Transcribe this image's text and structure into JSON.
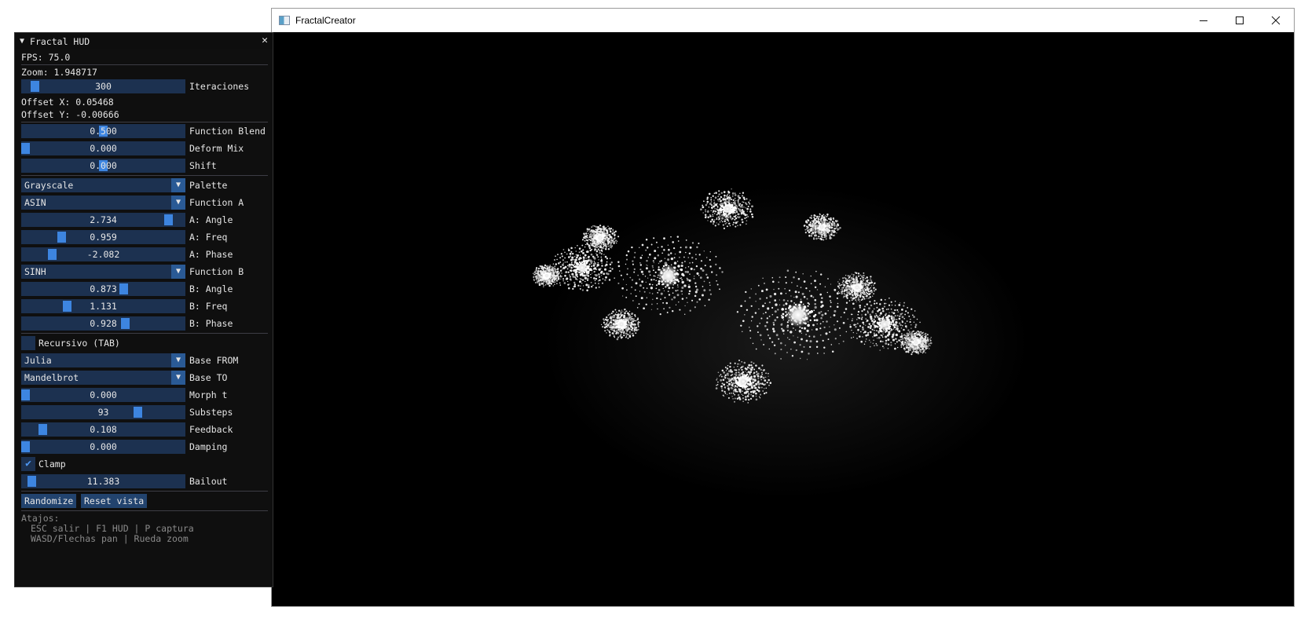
{
  "window": {
    "title": "FractalCreator",
    "controls": {
      "minimize_icon": "minimize-icon",
      "maximize_icon": "maximize-icon",
      "close_icon": "close-icon"
    }
  },
  "hud": {
    "title": "Fractal HUD",
    "collapse_icon": "▼",
    "close_icon": "✕",
    "fps": "FPS: 75.0",
    "zoom": "Zoom: 1.948717",
    "iteraciones": {
      "value": "300",
      "label": "Iteraciones",
      "level": 0.06
    },
    "offset_x": "Offset X: 0.05468",
    "offset_y": "Offset Y: -0.00666",
    "function_blend": {
      "value": "0.500",
      "label": "Function Blend",
      "level": 0.5
    },
    "deform_mix": {
      "value": "0.000",
      "label": "Deform Mix",
      "level": 0.0
    },
    "shift": {
      "value": "0.000",
      "label": "Shift",
      "level": 0.5
    },
    "palette": {
      "value": "Grayscale",
      "label": "Palette"
    },
    "function_a": {
      "value": "ASIN",
      "label": "Function A"
    },
    "a_angle": {
      "value": "2.734",
      "label": "A: Angle",
      "level": 0.92
    },
    "a_freq": {
      "value": "0.959",
      "label": "A: Freq",
      "level": 0.23
    },
    "a_phase": {
      "value": "-2.082",
      "label": "A: Phase",
      "level": 0.17
    },
    "function_b": {
      "value": "SINH",
      "label": "Function B"
    },
    "b_angle": {
      "value": "0.873",
      "label": "B: Angle",
      "level": 0.63
    },
    "b_freq": {
      "value": "1.131",
      "label": "B: Freq",
      "level": 0.27
    },
    "b_phase": {
      "value": "0.928",
      "label": "B: Phase",
      "level": 0.64
    },
    "recursivo": {
      "label": "Recursivo (TAB)",
      "checked": false
    },
    "base_from": {
      "value": "Julia",
      "label": "Base FROM"
    },
    "base_to": {
      "value": "Mandelbrot",
      "label": "Base TO"
    },
    "morph_t": {
      "value": "0.000",
      "label": "Morph t",
      "level": 0.0
    },
    "substeps": {
      "value": "93",
      "label": "Substeps",
      "level": 0.72
    },
    "feedback": {
      "value": "0.108",
      "label": "Feedback",
      "level": 0.11
    },
    "damping": {
      "value": "0.000",
      "label": "Damping",
      "level": 0.0
    },
    "clamp": {
      "label": "Clamp",
      "checked": true
    },
    "bailout": {
      "value": "11.383",
      "label": "Bailout",
      "level": 0.04
    },
    "randomize_label": "Randomize",
    "reset_label": "Reset vista",
    "shortcuts_title": "Atajos:",
    "shortcuts_line1": "ESC salir | F1 HUD | P captura",
    "shortcuts_line2": "WASD/Flechas pan | Rueda zoom"
  }
}
